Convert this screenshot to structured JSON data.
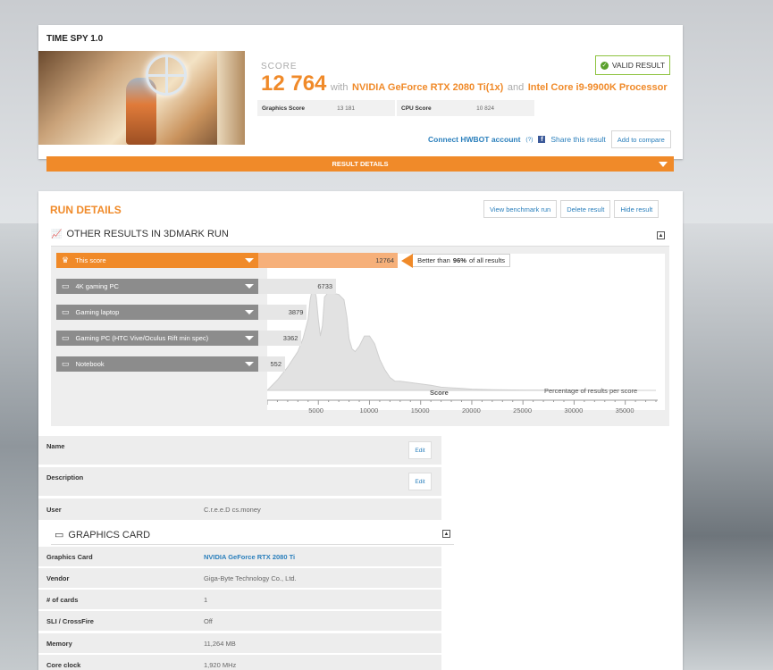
{
  "header": {
    "title": "TIME SPY 1.0",
    "score_label": "SCORE",
    "score": "12 764",
    "with_text": "with",
    "gpu": "NVIDIA GeForce RTX 2080 Ti(1x)",
    "and_text": "and",
    "cpu": "Intel Core i9-9900K Processor",
    "valid_label": "VALID RESULT",
    "graphics_score_label": "Graphics Score",
    "graphics_score": "13 181",
    "cpu_score_label": "CPU Score",
    "cpu_score": "10 824",
    "hwbot_link": "Connect HWBOT account",
    "hwbot_help": "(?)",
    "share_link": "Share this result",
    "compare_button": "Add to compare",
    "result_details": "RESULT DETAILS"
  },
  "run_details": {
    "title": "RUN DETAILS",
    "view_button": "View benchmark run",
    "delete_button": "Delete result",
    "hide_button": "Hide result",
    "other_results_title": "OTHER RESULTS IN 3DMARK RUN"
  },
  "chart_data": {
    "type": "area",
    "x_label": "Score",
    "y_label": "Percentage of results per score",
    "x_ticks": [
      "5000",
      "10000",
      "15000",
      "20000",
      "25000",
      "30000",
      "35000"
    ],
    "xlim": [
      0,
      38000
    ],
    "curve": {
      "x": [
        0,
        1000,
        2000,
        3000,
        3500,
        4000,
        4200,
        4500,
        4800,
        5000,
        5200,
        5400,
        5600,
        6000,
        6500,
        7000,
        7500,
        7800,
        8000,
        8300,
        8600,
        9000,
        9500,
        10000,
        10500,
        11000,
        11500,
        12000,
        12500,
        13000,
        14000,
        15000,
        16000,
        17000,
        18000,
        19000,
        20000,
        22000,
        25000,
        30000,
        38000
      ],
      "y": [
        0,
        0.08,
        0.18,
        0.3,
        0.4,
        0.55,
        0.7,
        0.82,
        0.72,
        0.55,
        0.42,
        0.5,
        0.72,
        0.76,
        0.75,
        0.74,
        0.7,
        0.56,
        0.4,
        0.32,
        0.3,
        0.34,
        0.42,
        0.42,
        0.36,
        0.24,
        0.16,
        0.1,
        0.07,
        0.07,
        0.06,
        0.05,
        0.04,
        0.025,
        0.02,
        0.015,
        0.01,
        0.005,
        0.003,
        0.002,
        0
      ]
    },
    "references": [
      {
        "name": "This score",
        "value": 12764,
        "value_label": "12764",
        "color": "#f08a29",
        "icon": "trophy-icon",
        "highlight": true
      },
      {
        "name": "4K gaming PC",
        "value": 6733,
        "value_label": "6733",
        "color": "#888888",
        "icon": "monitor-icon"
      },
      {
        "name": "Gaming laptop",
        "value": 3879,
        "value_label": "3879",
        "color": "#888888",
        "icon": "laptop-icon"
      },
      {
        "name": "Gaming PC (HTC Vive/Oculus Rift min spec)",
        "value": 3362,
        "value_label": "3362",
        "color": "#888888",
        "icon": "monitor-icon"
      },
      {
        "name": "Notebook",
        "value": 552,
        "value_label": "552",
        "color": "#888888",
        "icon": "laptop-icon"
      }
    ],
    "better_than_prefix": "Better than",
    "better_than_pct": "96%",
    "better_than_suffix": "of all results"
  },
  "info": {
    "name_label": "Name",
    "description_label": "Description",
    "user_label": "User",
    "user_value": "C.r.e.e.D cs.money",
    "edit_label": "Edit"
  },
  "graphics_card": {
    "title": "GRAPHICS CARD",
    "rows": [
      {
        "label": "Graphics Card",
        "value": "NVIDIA GeForce RTX 2080 Ti",
        "link": true
      },
      {
        "label": "Vendor",
        "value": "Giga-Byte Technology Co., Ltd."
      },
      {
        "label": "# of cards",
        "value": "1"
      },
      {
        "label": "SLI / CrossFire",
        "value": "Off"
      },
      {
        "label": "Memory",
        "value": "11,264 MB"
      },
      {
        "label": "Core clock",
        "value": "1,920 MHz"
      }
    ]
  },
  "colors": {
    "accent": "#f08a29",
    "link": "#2a7fbc",
    "valid": "#5aa02c"
  }
}
